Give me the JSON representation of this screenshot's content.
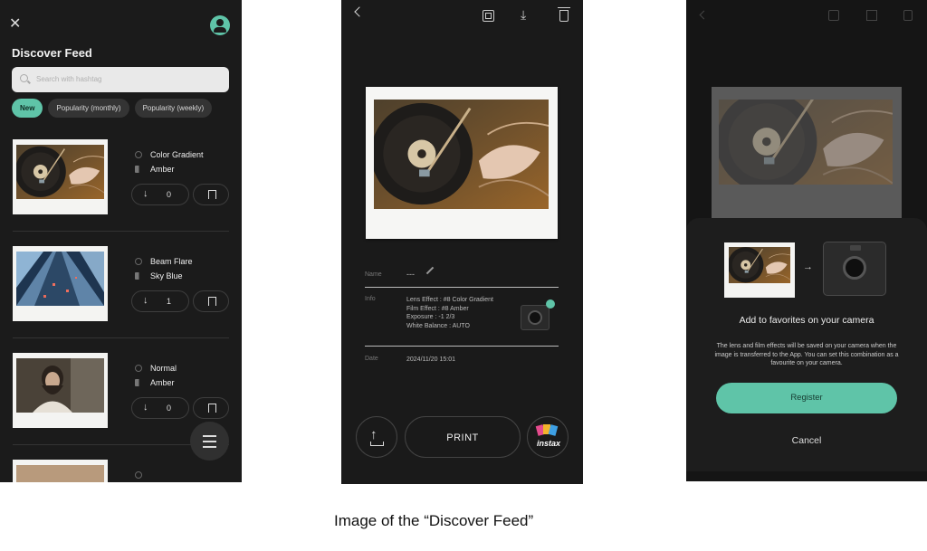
{
  "feed": {
    "title": "Discover Feed",
    "close_icon": "close-icon",
    "search_placeholder": "Search with hashtag",
    "chips": [
      "New",
      "Popularity (monthly)",
      "Popularity (weekly)"
    ],
    "active_chip": "New",
    "cards": [
      {
        "lens": "Color Gradient",
        "film": "Amber",
        "downloads": "0",
        "photo": "turntable"
      },
      {
        "lens": "Beam Flare",
        "film": "Sky Blue",
        "downloads": "1",
        "photo": "skyscraper"
      },
      {
        "lens": "Normal",
        "film": "Amber",
        "downloads": "0",
        "photo": "portrait"
      },
      {
        "lens": "",
        "film": "",
        "downloads": "",
        "photo": "partial"
      }
    ]
  },
  "detail": {
    "name_label": "Name",
    "name_value": "---",
    "info_label": "Info",
    "info_lines": [
      "Lens Effect : #8 Color Gradient",
      "Film Effect : #8 Amber",
      "Exposure : -1 2/3",
      "White Balance : AUTO"
    ],
    "date_label": "Date",
    "date_value": "2024/11/20 15:01",
    "print_label": "PRINT",
    "instax_label": "instax"
  },
  "modal": {
    "title": "Add to favorites on your camera",
    "description": "The lens and film effects will be saved on your camera when the image is transferred to the App. You can set this combination as a favourite on your camera.",
    "register_label": "Register",
    "cancel_label": "Cancel",
    "arrow": "→"
  },
  "caption": {
    "prefix": "Image of the ",
    "quoted": "“Discover Feed”"
  },
  "colors": {
    "accent": "#5fc4a8",
    "background": "#1b1b1b"
  }
}
